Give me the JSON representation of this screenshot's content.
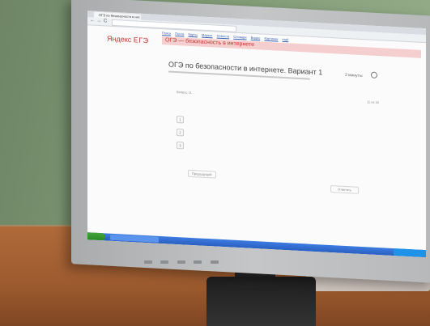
{
  "browser": {
    "tab_title": "ОГЭ по безопасности в инт...",
    "back_glyph": "←",
    "forward_glyph": "→",
    "reload_glyph": "C"
  },
  "site": {
    "links": [
      "Поиск",
      "Почта",
      "Карты",
      "Маркет",
      "Новости",
      "Словари",
      "Видео",
      "Картинки",
      "ещё"
    ],
    "logo_left": "Яндекс",
    "logo_right": "ЕГЭ",
    "breadcrumb": "ОГЭ — безопасность в интернете"
  },
  "test": {
    "title": "ОГЭ по безопасности в интернете. Вариант 1",
    "timer": "2 минуты",
    "question_number": "Вопрос 11",
    "question_count": "11 из 16",
    "options": [
      {
        "key": "1"
      },
      {
        "key": "2"
      },
      {
        "key": "3"
      }
    ],
    "prev_button": "Предыдущий",
    "next_button": "Ответить"
  }
}
